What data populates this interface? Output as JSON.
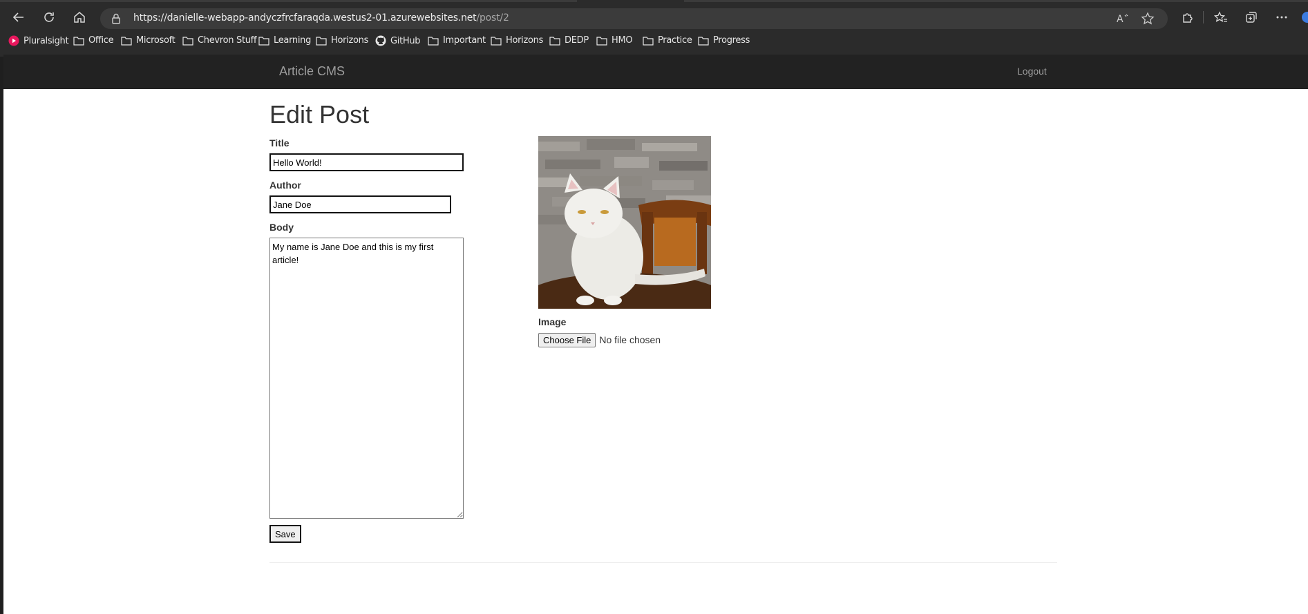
{
  "browser": {
    "url_host": "https://danielle-webapp-andyczfrcfaraqda.westus2-01.azurewebsites.net",
    "url_path": "/post/2",
    "bookmarks": [
      "Pluralsight",
      "Office",
      "Microsoft",
      "Chevron Stuff",
      "Learning",
      "Horizons",
      "GitHub",
      "Important",
      "Horizons",
      "DEDP",
      "HMO",
      "Practice",
      "Progress"
    ]
  },
  "navbar": {
    "brand": "Article CMS",
    "logout": "Logout"
  },
  "page": {
    "title": "Edit Post",
    "title_label": "Title",
    "title_value": "Hello World!",
    "author_label": "Author",
    "author_value": "Jane Doe",
    "body_label": "Body",
    "body_value": "My name is Jane Doe and this is my first article!",
    "save_label": "Save",
    "image_label": "Image",
    "choose_file_label": "Choose File",
    "no_file_text": "No file chosen"
  },
  "icons": {
    "back": "back-arrow-icon",
    "refresh": "refresh-icon",
    "home": "home-icon",
    "lock": "lock-icon",
    "read_aloud": "read-aloud-icon",
    "favorite": "star-icon",
    "extensions": "puzzle-icon",
    "favorites": "favorites-icon",
    "collections": "collections-icon",
    "more": "more-icon",
    "folder": "folder-icon",
    "github": "github-icon",
    "pluralsight": "pluralsight-icon"
  },
  "colors": {
    "navbar": "#222222",
    "brand": "#9d9d9d",
    "text": "#333333",
    "pluralsight": "#e8175d"
  }
}
